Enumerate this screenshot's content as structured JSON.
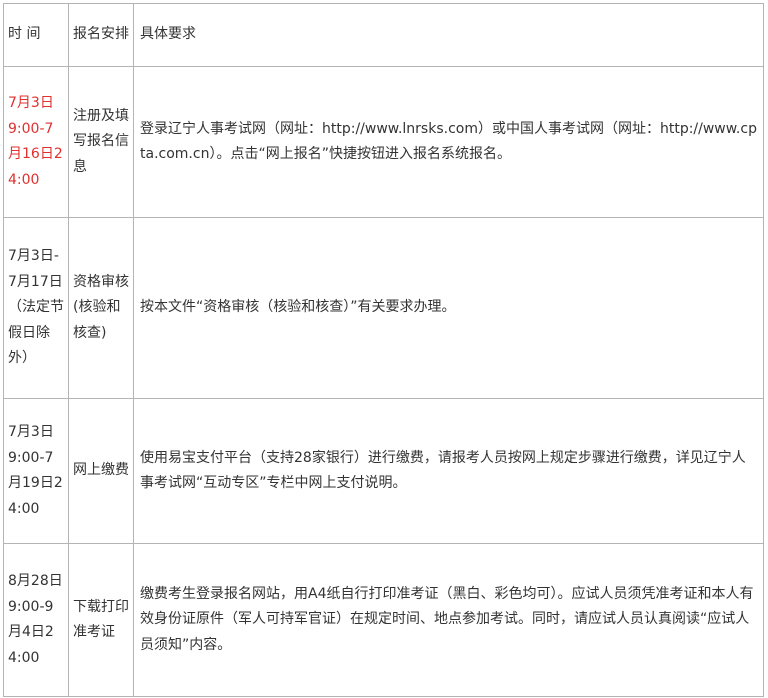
{
  "table": {
    "headers": [
      "时 间",
      "报名安排",
      "具体要求"
    ],
    "rows": [
      {
        "time": "7月3日9:00-7月16日24:00",
        "time_highlight": "#e03030",
        "step": "注册及填写报名信息",
        "detail": "登录辽宁人事考试网（网址：http://www.lnrsks.com）或中国人事考试网（网址：http://www.cpta.com.cn）。点击“网上报名”快捷按钮进入报名系统报名。"
      },
      {
        "time": "7月3日-7月17日（法定节假日除外）",
        "step": "资格审核(核验和核查)",
        "detail": "按本文件“资格审核（核验和核查）”有关要求办理。"
      },
      {
        "time": "7月3日9:00-7月19日24:00",
        "step": "网上缴费",
        "detail": "使用易宝支付平台（支持28家银行）进行缴费，请报考人员按网上规定步骤进行缴费，详见辽宁人事考试网“互动专区”专栏中网上支付说明。"
      },
      {
        "time": "8月28日9:00-9月4日24:00",
        "step": "下载打印准考证",
        "detail": "缴费考生登录报名网站，用A4纸自行打印准考证（黑白、彩色均可）。应试人员须凭准考证和本人有效身份证原件（军人可持军官证）在规定时间、地点参加考试。同时，请应试人员认真阅读“应试人员须知”内容。"
      }
    ]
  }
}
